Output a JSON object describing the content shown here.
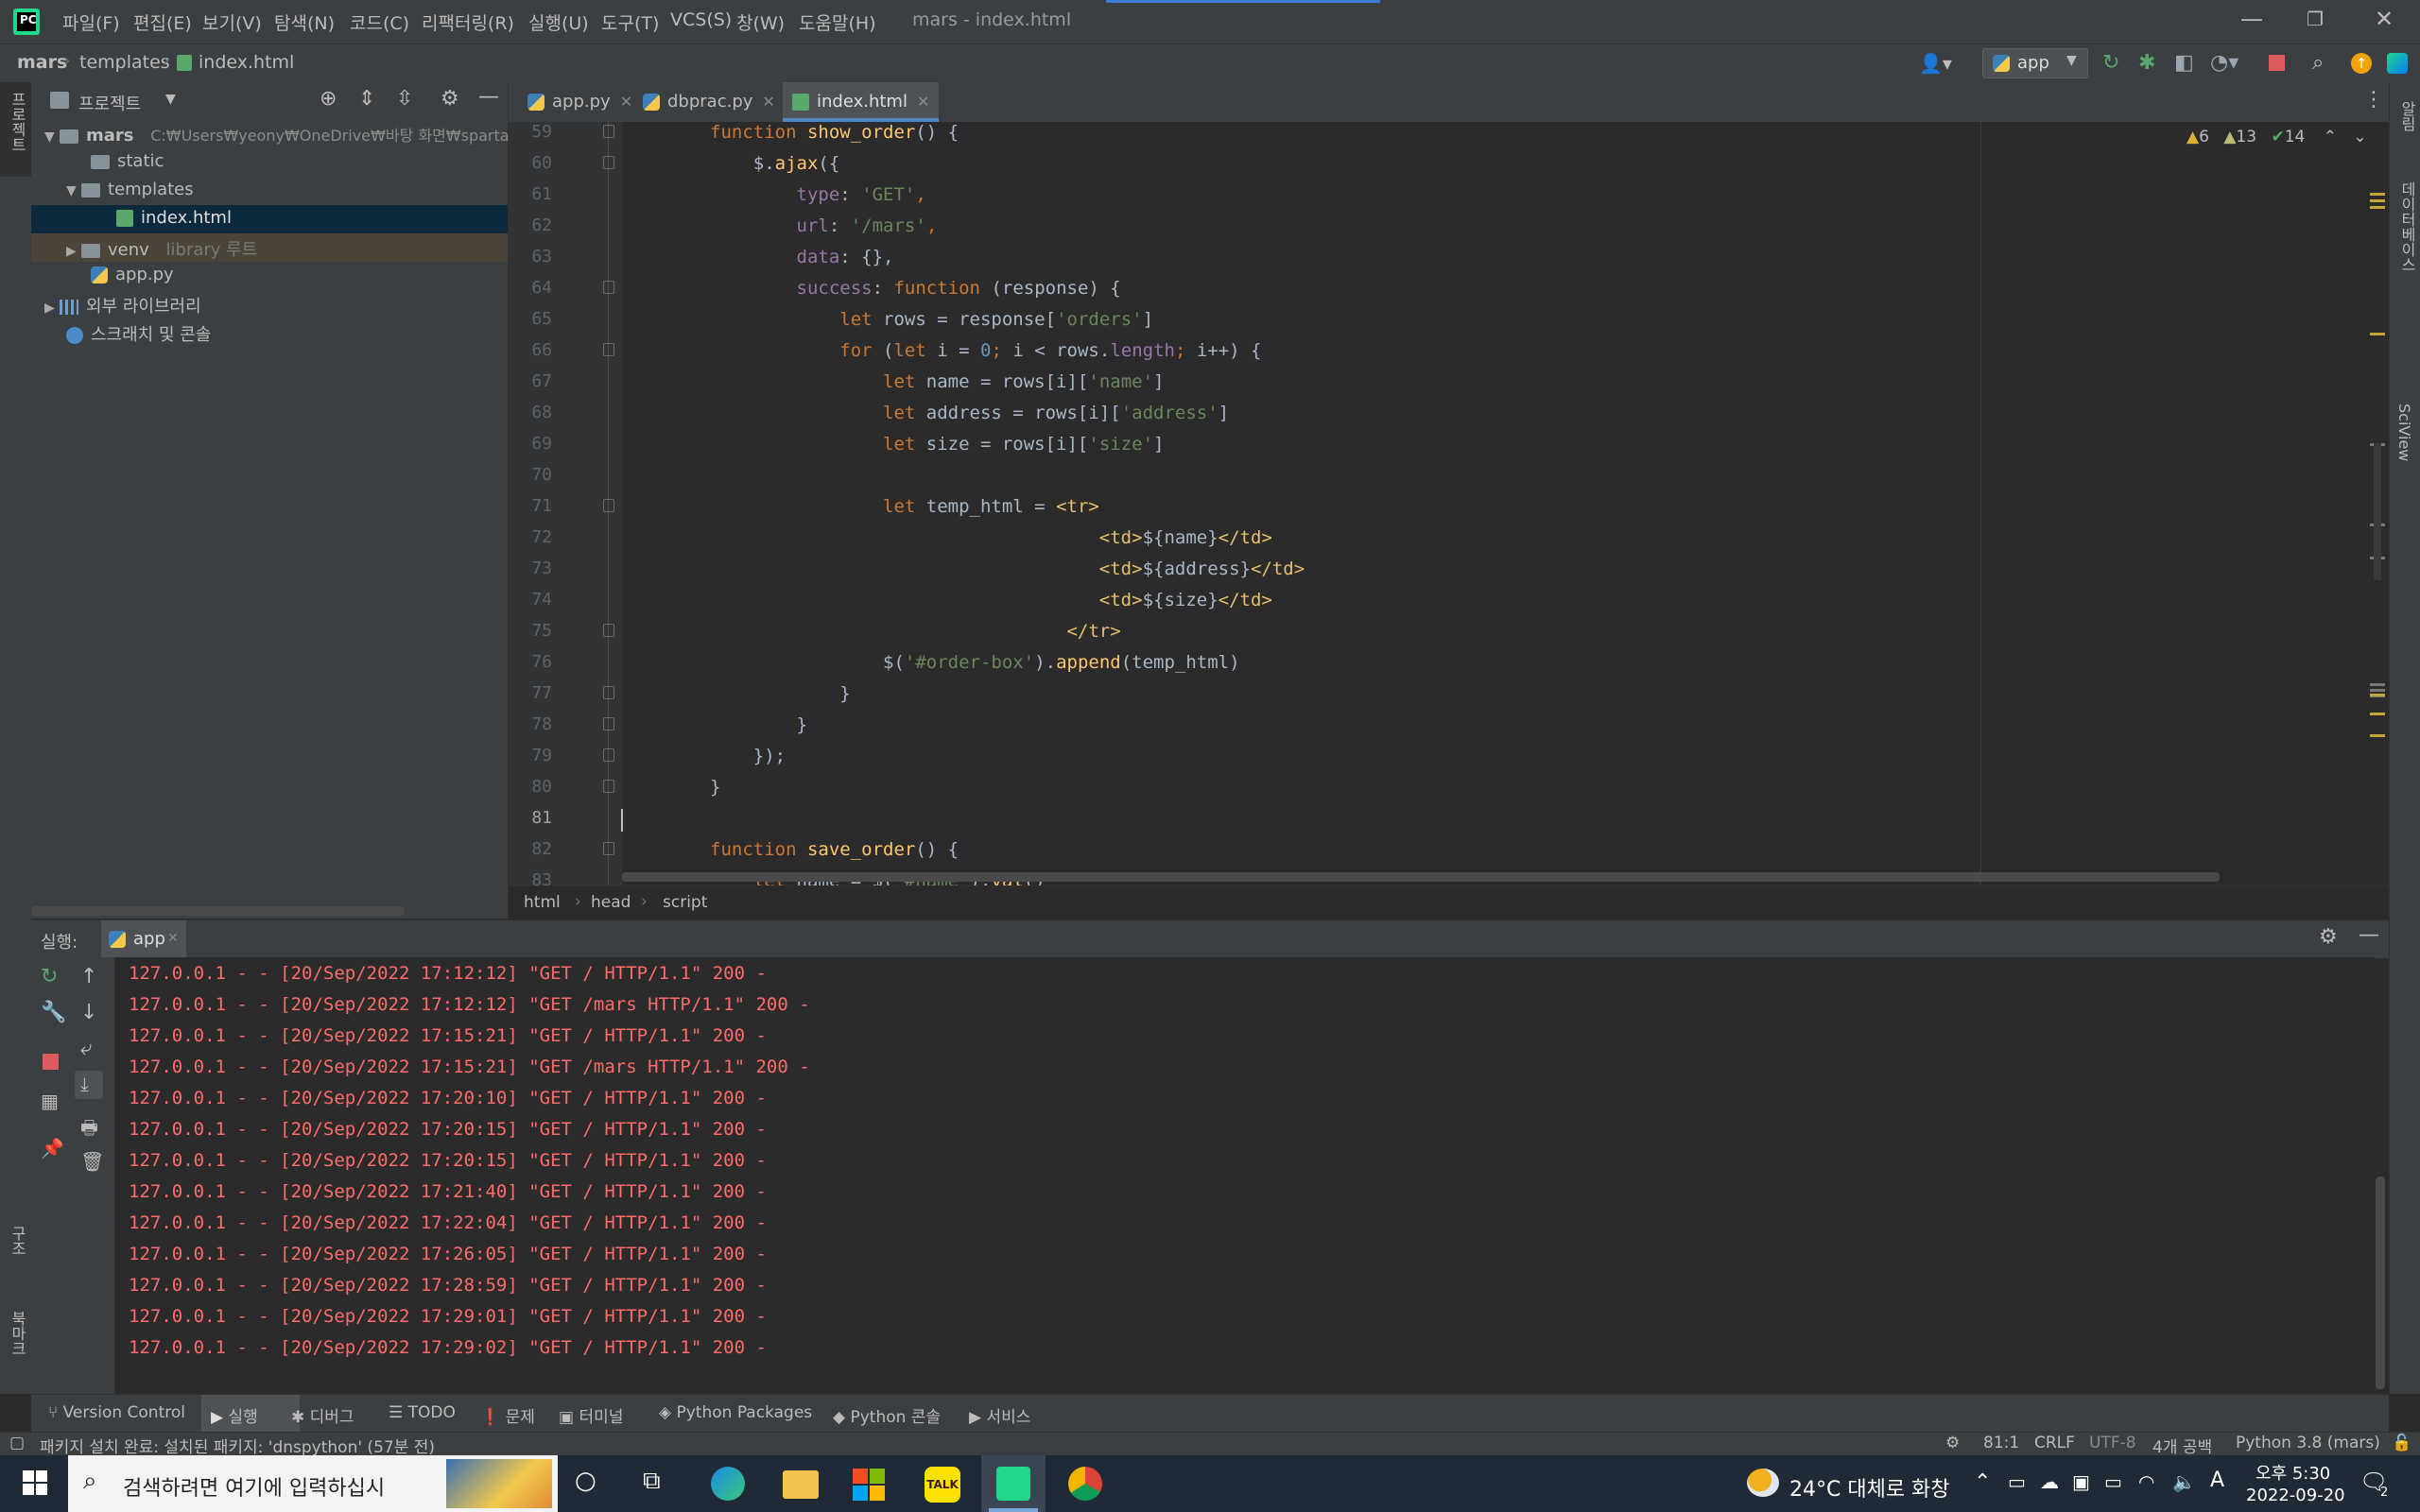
{
  "titlebar": {
    "menus": [
      "파일(F)",
      "편집(E)",
      "보기(V)",
      "탐색(N)",
      "코드(C)",
      "리팩터링(R)",
      "실행(U)",
      "도구(T)",
      "VCS(S)",
      "창(W)",
      "도움말(H)"
    ],
    "window_title": "mars - index.html",
    "logo_text": "PC",
    "minimize": "—",
    "restore": "❐",
    "close": "✕"
  },
  "navbar": {
    "breadcrumbs": [
      "mars",
      "templates",
      "index.html"
    ],
    "run_config": "app"
  },
  "project": {
    "title": "프로젝트",
    "root_name": "mars",
    "root_path": "C:₩Users₩yeony₩OneDrive₩바탕 화면₩sparta₩",
    "static": "static",
    "templates": "templates",
    "index_file": "index.html",
    "venv": "venv",
    "venv_hint": "library 루트",
    "app_file": "app.py",
    "external_libs": "외부 라이브러리",
    "scratches": "스크래치 및 콘솔"
  },
  "left_strip": {
    "project_tab": "프로젝트",
    "structure_tab": "구조",
    "bookmarks_tab": "북마크"
  },
  "right_strip": {
    "notifications_tab": "알림",
    "database_tab": "데이터베이스",
    "sciview_tab": "SciView"
  },
  "editor": {
    "tabs": [
      "app.py",
      "dbprac.py",
      "index.html"
    ],
    "inspections": {
      "warnings": "6",
      "weak_warnings": "13",
      "typos": "14"
    },
    "line_numbers": [
      "59",
      "60",
      "61",
      "62",
      "63",
      "64",
      "65",
      "66",
      "67",
      "68",
      "69",
      "70",
      "71",
      "72",
      "73",
      "74",
      "75",
      "76",
      "77",
      "78",
      "79",
      "80",
      "81",
      "82",
      "83"
    ],
    "code_lines": [
      [
        [
          "kw",
          "function "
        ],
        [
          "fn",
          "show_order"
        ],
        [
          "plain",
          "() {"
        ]
      ],
      [
        [
          "plain",
          "    $."
        ],
        [
          "fn",
          "ajax"
        ],
        [
          "plain",
          "({"
        ]
      ],
      [
        [
          "prop",
          "        type"
        ],
        [
          "plain",
          ": "
        ],
        [
          "str",
          "'GET'"
        ],
        [
          "kw",
          ","
        ]
      ],
      [
        [
          "prop",
          "        url"
        ],
        [
          "plain",
          ": "
        ],
        [
          "str",
          "'/mars'"
        ],
        [
          "kw",
          ","
        ]
      ],
      [
        [
          "prop",
          "        data"
        ],
        [
          "plain",
          ": {},"
        ]
      ],
      [
        [
          "prop",
          "        success"
        ],
        [
          "plain",
          ": "
        ],
        [
          "kw",
          "function "
        ],
        [
          "plain",
          "(response) {"
        ]
      ],
      [
        [
          "kw",
          "            let "
        ],
        [
          "plain",
          "rows = response["
        ],
        [
          "str",
          "'orders'"
        ],
        [
          "plain",
          "]"
        ]
      ],
      [
        [
          "kw",
          "            for "
        ],
        [
          "plain",
          "("
        ],
        [
          "kw",
          "let "
        ],
        [
          "plain",
          "i = "
        ],
        [
          "num",
          "0"
        ],
        [
          "kw",
          "; "
        ],
        [
          "plain",
          "i < rows."
        ],
        [
          "prop",
          "length"
        ],
        [
          "kw",
          "; "
        ],
        [
          "plain",
          "i++) {"
        ]
      ],
      [
        [
          "kw",
          "                let "
        ],
        [
          "plain",
          "name = rows[i]["
        ],
        [
          "str",
          "'name'"
        ],
        [
          "plain",
          "]"
        ]
      ],
      [
        [
          "kw",
          "                let "
        ],
        [
          "plain",
          "address = rows[i]["
        ],
        [
          "str",
          "'address'"
        ],
        [
          "plain",
          "]"
        ]
      ],
      [
        [
          "kw",
          "                let "
        ],
        [
          "plain",
          "size = rows[i]["
        ],
        [
          "str",
          "'size'"
        ],
        [
          "plain",
          "]"
        ]
      ],
      [
        [
          "plain",
          ""
        ]
      ],
      [
        [
          "kw",
          "                let "
        ],
        [
          "plain",
          "temp_html = "
        ],
        [
          "tag",
          "<tr>"
        ]
      ],
      [
        [
          "tag",
          "                                    <td>"
        ],
        [
          "plain",
          "${name}"
        ],
        [
          "tag",
          "</td>"
        ]
      ],
      [
        [
          "tag",
          "                                    <td>"
        ],
        [
          "plain",
          "${address}"
        ],
        [
          "tag",
          "</td>"
        ]
      ],
      [
        [
          "tag",
          "                                    <td>"
        ],
        [
          "plain",
          "${size}"
        ],
        [
          "tag",
          "</td>"
        ]
      ],
      [
        [
          "tag",
          "                                 </tr>"
        ]
      ],
      [
        [
          "plain",
          "                $("
        ],
        [
          "str",
          "'#order-box'"
        ],
        [
          "plain",
          ")."
        ],
        [
          "fn",
          "append"
        ],
        [
          "plain",
          "(temp_html)"
        ]
      ],
      [
        [
          "plain",
          "            }"
        ]
      ],
      [
        [
          "plain",
          "        }"
        ]
      ],
      [
        [
          "plain",
          "    });"
        ]
      ],
      [
        [
          "plain",
          "}"
        ]
      ],
      [
        [
          "plain",
          ""
        ]
      ],
      [
        [
          "kw",
          "function "
        ],
        [
          "fn",
          "save_order"
        ],
        [
          "plain",
          "() {"
        ]
      ],
      [
        [
          "kw",
          "    let "
        ],
        [
          "plain",
          "name = $("
        ],
        [
          "str",
          "'#name'"
        ],
        [
          "plain",
          ")."
        ],
        [
          "fn",
          "val"
        ],
        [
          "plain",
          "()"
        ]
      ]
    ],
    "path_crumbs": [
      "html",
      "head",
      "script"
    ]
  },
  "run_panel": {
    "label": "실행:",
    "tab": "app",
    "logs": [
      "127.0.0.1 - - [20/Sep/2022 17:12:12] \"GET / HTTP/1.1\" 200 -",
      "127.0.0.1 - - [20/Sep/2022 17:12:12] \"GET /mars HTTP/1.1\" 200 -",
      "127.0.0.1 - - [20/Sep/2022 17:15:21] \"GET / HTTP/1.1\" 200 -",
      "127.0.0.1 - - [20/Sep/2022 17:15:21] \"GET /mars HTTP/1.1\" 200 -",
      "127.0.0.1 - - [20/Sep/2022 17:20:10] \"GET / HTTP/1.1\" 200 -",
      "127.0.0.1 - - [20/Sep/2022 17:20:15] \"GET / HTTP/1.1\" 200 -",
      "127.0.0.1 - - [20/Sep/2022 17:20:15] \"GET / HTTP/1.1\" 200 -",
      "127.0.0.1 - - [20/Sep/2022 17:21:40] \"GET / HTTP/1.1\" 200 -",
      "127.0.0.1 - - [20/Sep/2022 17:22:04] \"GET / HTTP/1.1\" 200 -",
      "127.0.0.1 - - [20/Sep/2022 17:26:05] \"GET / HTTP/1.1\" 200 -",
      "127.0.0.1 - - [20/Sep/2022 17:28:59] \"GET / HTTP/1.1\" 200 -",
      "127.0.0.1 - - [20/Sep/2022 17:29:01] \"GET / HTTP/1.1\" 200 -",
      "127.0.0.1 - - [20/Sep/2022 17:29:02] \"GET / HTTP/1.1\" 200 -"
    ]
  },
  "tool_tabs": [
    "Version Control",
    "실행",
    "디버그",
    "TODO",
    "문제",
    "터미널",
    "Python Packages",
    "Python 콘솔",
    "서비스"
  ],
  "status": {
    "message": "패키지 설치 완료: 설치된 패키지: 'dnspython' (57분 전)",
    "position": "81:1",
    "line_sep": "CRLF",
    "encoding": "UTF-8",
    "indent": "4개 공백",
    "interpreter": "Python 3.8 (mars)"
  },
  "taskbar": {
    "search_placeholder": "검색하려면 여기에 입력하십시",
    "weather": "24°C 대체로 화창",
    "time": "오후 5:30",
    "date": "2022-09-20",
    "notif_count": "2",
    "ime": "A",
    "kakao_label": "TALK"
  },
  "colors": {
    "accent": "#4a88c7",
    "log_red": "#ff6b68",
    "keyword": "#cc7832",
    "function": "#ffc66d",
    "string": "#6a8759"
  }
}
